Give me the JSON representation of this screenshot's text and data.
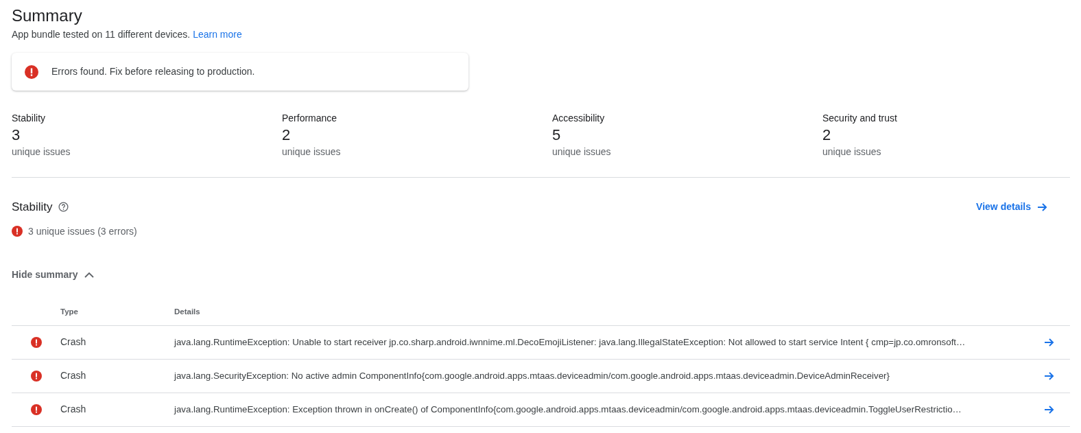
{
  "title": "Summary",
  "subtitle": {
    "text": "App bundle tested on 11 different devices.",
    "link": "Learn more"
  },
  "alert": {
    "kind": "error",
    "text": "Errors found. Fix before releasing to production."
  },
  "metrics": [
    {
      "label": "Stability",
      "value": "3",
      "caption": "unique issues"
    },
    {
      "label": "Performance",
      "value": "2",
      "caption": "unique issues"
    },
    {
      "label": "Accessibility",
      "value": "5",
      "caption": "unique issues"
    },
    {
      "label": "Security and trust",
      "value": "2",
      "caption": "unique issues"
    }
  ],
  "section": {
    "title": "Stability",
    "link": "View details",
    "issues": {
      "kind": "error",
      "text": "3 unique issues (3 errors)"
    },
    "toggle": {
      "label": "Hide summary",
      "expanded": true
    }
  },
  "table": {
    "columns": [
      "Type",
      "Details"
    ],
    "rows": [
      {
        "kind": "error",
        "type": "Crash",
        "details": "java.lang.RuntimeException: Unable to start receiver jp.co.sharp.android.iwnnime.ml.DecoEmojiListener: java.lang.IllegalStateException: Not allowed to start service Intent { cmp=jp.co.omronsoft…"
      },
      {
        "kind": "error",
        "type": "Crash",
        "details": "java.lang.SecurityException: No active admin ComponentInfo{com.google.android.apps.mtaas.deviceadmin/com.google.android.apps.mtaas.deviceadmin.DeviceAdminReceiver}"
      },
      {
        "kind": "error",
        "type": "Crash",
        "details": "java.lang.RuntimeException: Exception thrown in onCreate() of ComponentInfo{com.google.android.apps.mtaas.deviceadmin/com.google.android.apps.mtaas.deviceadmin.ToggleUserRestrictio…"
      }
    ]
  }
}
